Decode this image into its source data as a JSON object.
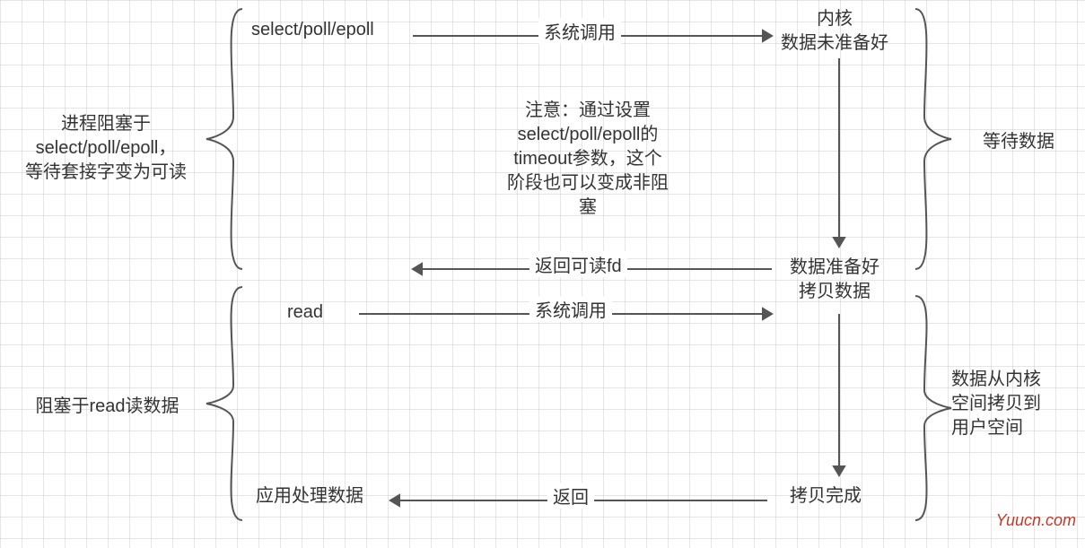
{
  "diagram": {
    "leftBrace1": "进程阻塞于\nselect/poll/epoll，\n等待套接字变为可读",
    "leftBrace2": "阻塞于read读数据",
    "rightBrace1": "等待数据",
    "rightBrace2": "数据从内核\n空间拷贝到\n用户空间",
    "col1": {
      "top": "select/poll/epoll",
      "mid": "read",
      "bottom": "应用处理数据"
    },
    "col2": {
      "top": "内核\n数据未准备好",
      "mid": "数据准备好\n拷贝数据",
      "bottom": "拷贝完成"
    },
    "arrows": {
      "syscall1": "系统调用",
      "returnFd": "返回可读fd",
      "syscall2": "系统调用",
      "ret": "返回"
    },
    "note": "注意：通过设置\nselect/poll/epoll的\ntimeout参数，这个\n阶段也可以变成非阻\n塞",
    "watermark": "Yuucn.com"
  }
}
